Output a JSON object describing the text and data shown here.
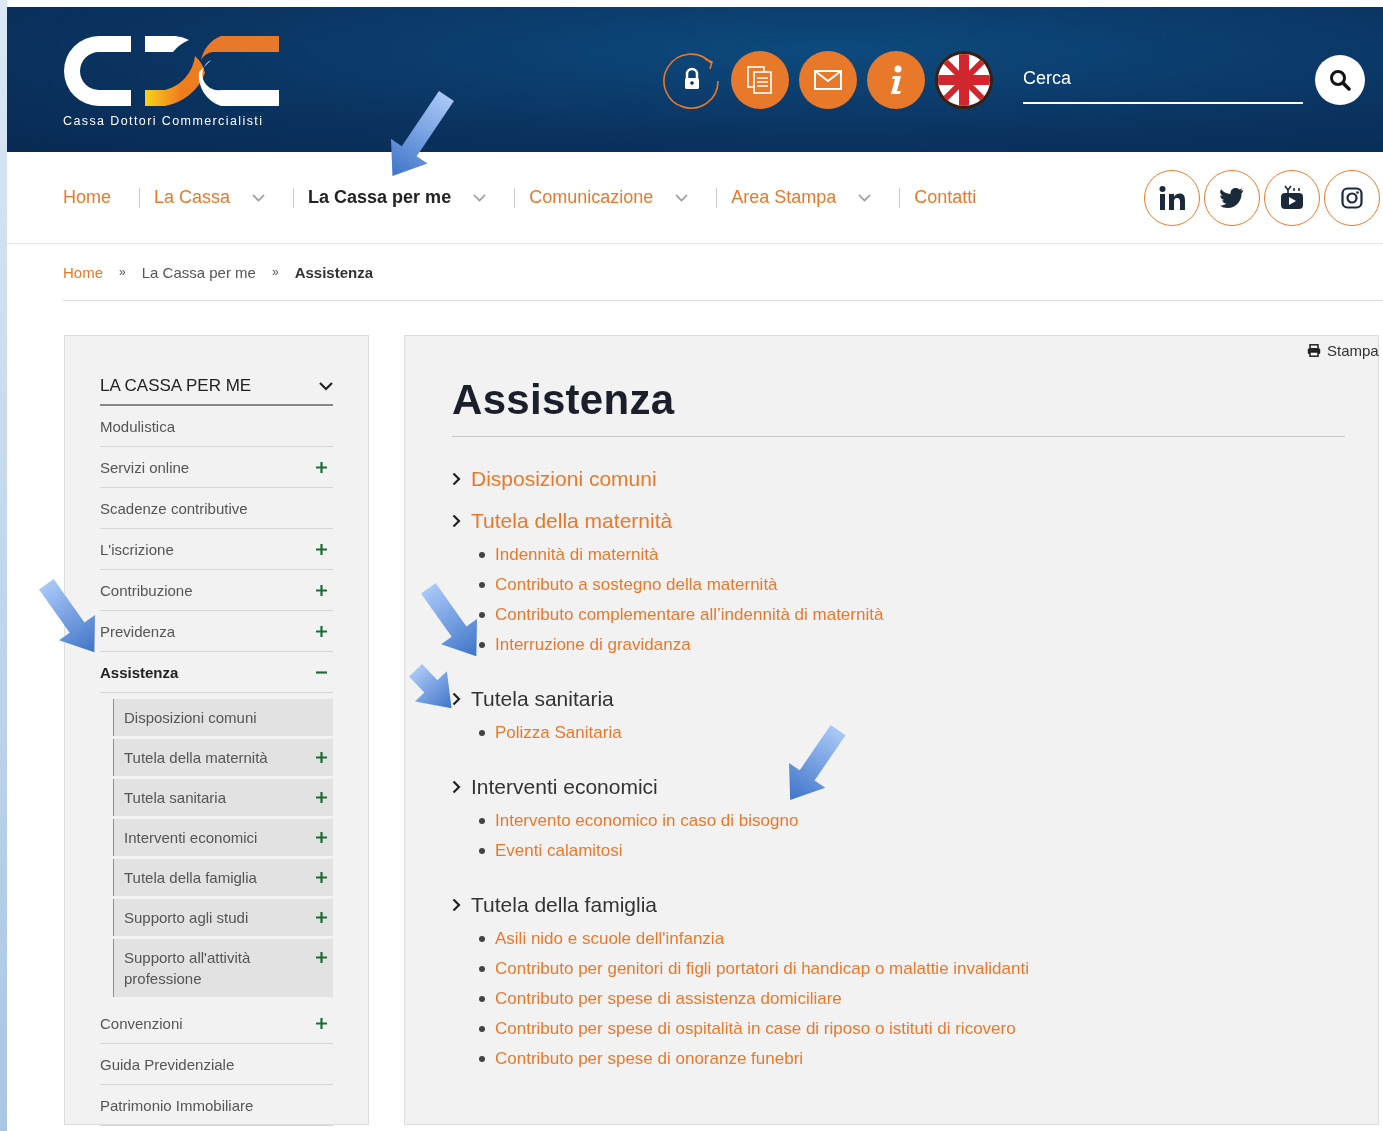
{
  "header": {
    "logo_subtitle": "Cassa Dottori Commercialisti",
    "tools": [
      {
        "kind": "lock"
      },
      {
        "kind": "documents"
      },
      {
        "kind": "mail"
      },
      {
        "kind": "info"
      },
      {
        "kind": "flag"
      }
    ],
    "search": {
      "placeholder": "Cerca"
    }
  },
  "nav": {
    "items": [
      {
        "label": "Home",
        "dropdown": false,
        "selected": false
      },
      {
        "label": "La Cassa",
        "dropdown": true,
        "selected": false
      },
      {
        "label": "La Cassa per me",
        "dropdown": true,
        "selected": true
      },
      {
        "label": "Comunicazione",
        "dropdown": true,
        "selected": false
      },
      {
        "label": "Area Stampa",
        "dropdown": true,
        "selected": false
      },
      {
        "label": "Contatti",
        "dropdown": false,
        "selected": false
      }
    ],
    "social": [
      {
        "kind": "linkedin"
      },
      {
        "kind": "twitter"
      },
      {
        "kind": "youtube"
      },
      {
        "kind": "instagram"
      }
    ]
  },
  "breadcrumb": {
    "separator": "»",
    "items": [
      {
        "label": "Home",
        "selected": false
      },
      {
        "label": "La Cassa per me",
        "selected": false
      },
      {
        "label": "Assistenza",
        "selected": true
      }
    ]
  },
  "sidebar": {
    "title": "LA CASSA PER ME",
    "items": [
      {
        "label": "Modulistica",
        "expandable": false,
        "selected": false
      },
      {
        "label": "Servizi online",
        "expandable": true,
        "expanded": false,
        "selected": false
      },
      {
        "label": "Scadenze contributive",
        "expandable": false,
        "selected": false
      },
      {
        "label": "L'iscrizione",
        "expandable": true,
        "expanded": false,
        "selected": false
      },
      {
        "label": "Contribuzione",
        "expandable": true,
        "expanded": false,
        "selected": false
      },
      {
        "label": "Previdenza",
        "expandable": true,
        "expanded": false,
        "selected": false
      },
      {
        "label": "Assistenza",
        "expandable": true,
        "expanded": true,
        "selected": true,
        "children": [
          {
            "label": "Disposizioni comuni",
            "expandable": false
          },
          {
            "label": "Tutela della maternità",
            "expandable": true
          },
          {
            "label": "Tutela sanitaria",
            "expandable": true
          },
          {
            "label": "Interventi economici",
            "expandable": true
          },
          {
            "label": "Tutela della famiglia",
            "expandable": true
          },
          {
            "label": "Supporto agli studi",
            "expandable": true
          },
          {
            "label": "Supporto all'attività professione",
            "expandable": true
          }
        ]
      },
      {
        "label": "Convenzioni",
        "expandable": true,
        "expanded": false,
        "selected": false
      },
      {
        "label": "Guida Previdenziale",
        "expandable": false,
        "selected": false
      },
      {
        "label": "Patrimonio Immobiliare",
        "expandable": false,
        "selected": false
      }
    ]
  },
  "main": {
    "print": "Stampa",
    "title": "Assistenza",
    "sections": [
      {
        "title": "Disposizioni comuni",
        "kind": "link"
      },
      {
        "title": "Tutela della maternità",
        "kind": "link",
        "children": [
          "Indennità di maternità",
          "Contributo a sostegno della maternità",
          "Contributo complementare all’indennità di maternità",
          "Interruzione di gravidanza"
        ]
      },
      {
        "title": "Tutela sanitaria",
        "kind": "heading",
        "children": [
          "Polizza Sanitaria"
        ]
      },
      {
        "title": "Interventi economici",
        "kind": "heading",
        "children": [
          "Intervento economico in caso di bisogno",
          "Eventi calamitosi"
        ]
      },
      {
        "title": "Tutela della famiglia",
        "kind": "heading",
        "children": [
          "Asili nido e scuole dell'infanzia",
          "Contributo per genitori di figli portatori di handicap o malattie invalidanti",
          "Contributo per spese di assistenza domiciliare",
          "Contributo per spese di ospitalità in case di riposo o istituti di ricovero",
          "Contributo per spese di onoranze funebri"
        ]
      }
    ]
  }
}
